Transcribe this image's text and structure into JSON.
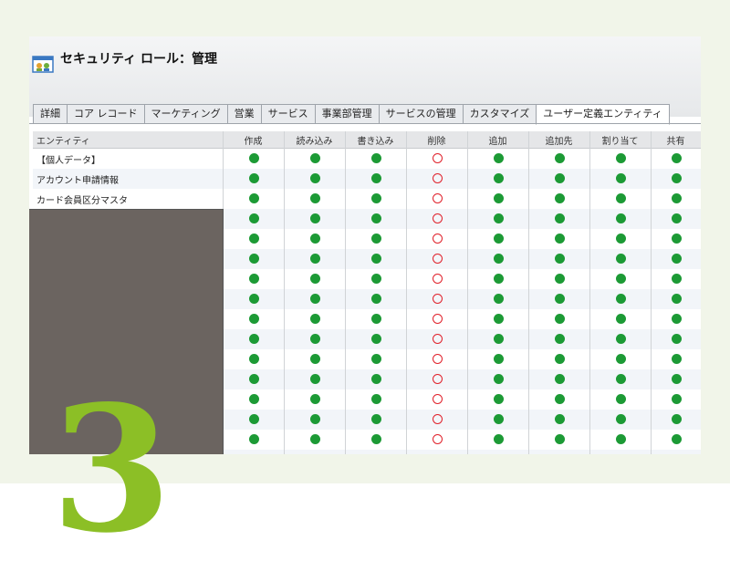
{
  "page": {
    "title": "セキュリティ ロール：管理",
    "big_digit": "3"
  },
  "tabs": [
    {
      "label": "詳細",
      "active": false
    },
    {
      "label": "コア レコード",
      "active": false
    },
    {
      "label": "マーケティング",
      "active": false
    },
    {
      "label": "営業",
      "active": false
    },
    {
      "label": "サービス",
      "active": false
    },
    {
      "label": "事業部管理",
      "active": false
    },
    {
      "label": "サービスの管理",
      "active": false
    },
    {
      "label": "カスタマイズ",
      "active": false
    },
    {
      "label": "ユーザー定義エンティティ",
      "active": true
    }
  ],
  "table": {
    "entity_header": "エンティティ",
    "columns": [
      "作成",
      "読み込み",
      "書き込み",
      "削除",
      "追加",
      "追加先",
      "割り当て",
      "共有"
    ],
    "rows": [
      {
        "name": "【個人データ】"
      },
      {
        "name": "アカウント申請情報"
      },
      {
        "name": "カード会員区分マスタ"
      },
      {
        "name": ""
      },
      {
        "name": ""
      },
      {
        "name": ""
      },
      {
        "name": ""
      },
      {
        "name": ""
      },
      {
        "name": ""
      },
      {
        "name": ""
      },
      {
        "name": ""
      },
      {
        "name": ""
      },
      {
        "name": ""
      },
      {
        "name": ""
      },
      {
        "name": ""
      },
      {
        "name": ""
      }
    ],
    "privilege_pattern": [
      "full",
      "full",
      "full",
      "none",
      "full",
      "full",
      "full",
      "full"
    ]
  },
  "colors": {
    "granted": "#1c9a35",
    "not_granted": "#e0202a",
    "accent_green": "#8cbf26"
  }
}
